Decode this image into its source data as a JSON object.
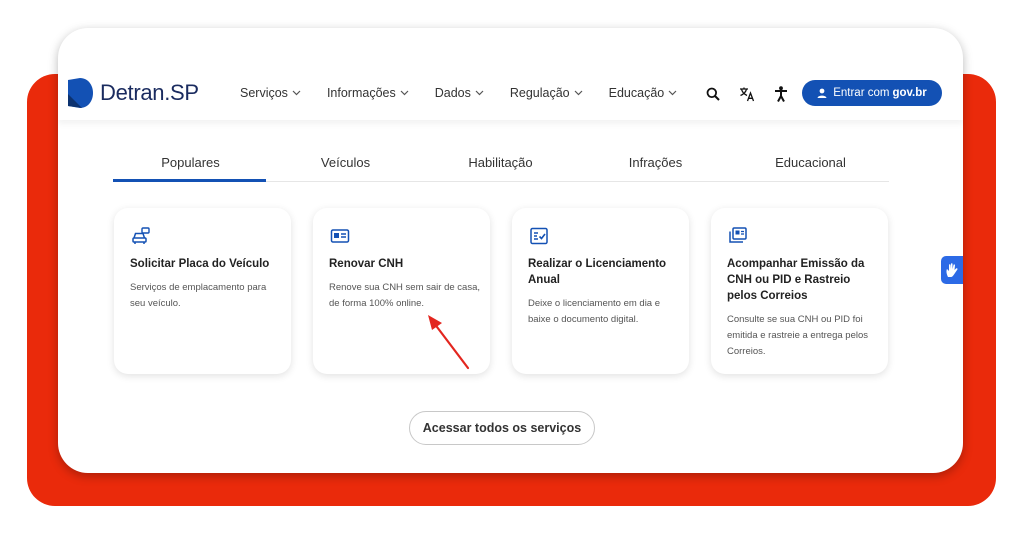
{
  "brand": {
    "logo_name": "Detran",
    "logo_suffix": ".SP",
    "logo_color": "#1a2b5f"
  },
  "nav": [
    {
      "label": "Serviços"
    },
    {
      "label": "Informações"
    },
    {
      "label": "Dados"
    },
    {
      "label": "Regulação"
    },
    {
      "label": "Educação"
    }
  ],
  "header_icons": [
    "search-icon",
    "translate-icon",
    "accessibility-icon"
  ],
  "login": {
    "prefix": "Entrar com",
    "brand": "gov.br",
    "color": "#1351b4"
  },
  "tabs": [
    {
      "label": "Populares",
      "active": true
    },
    {
      "label": "Veículos"
    },
    {
      "label": "Habilitação"
    },
    {
      "label": "Infrações"
    },
    {
      "label": "Educacional"
    }
  ],
  "services": [
    {
      "title": "Solicitar Placa do Veículo",
      "description": "Serviços de emplacamento para seu veículo.",
      "icon": "car-plate-icon"
    },
    {
      "title": "Renovar CNH",
      "description": "Renove sua CNH sem sair de casa, de forma 100% online.",
      "icon": "id-card-icon"
    },
    {
      "title": "Realizar o Licenciamento Anual",
      "description": "Deixe o licenciamento em dia e baixe o documento digital.",
      "icon": "document-check-icon"
    },
    {
      "title": "Acompanhar Emissão da CNH ou PID e Rastreio pelos Correios",
      "description": "Consulte se sua CNH ou PID foi emitida e rastreie a entrega pelos Correios.",
      "icon": "cards-stack-icon"
    }
  ],
  "all_services_button": "Acessar todos os serviços",
  "colors": {
    "accent": "#1351b4",
    "frame_red": "#ea2a0b",
    "arrow": "#e3261f",
    "vlibras": "#2c6ae6"
  }
}
